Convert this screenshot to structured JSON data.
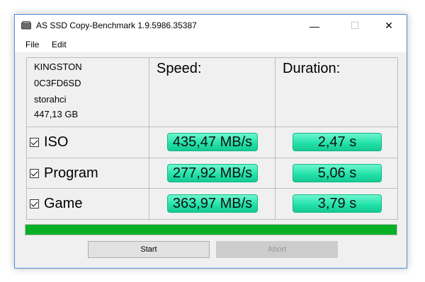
{
  "window": {
    "title": "AS SSD Copy-Benchmark 1.9.5986.35387"
  },
  "titlebar": {
    "minimize_glyph": "—",
    "maximize_glyph": "☐",
    "close_glyph": "✕"
  },
  "menu": [
    "File",
    "Edit"
  ],
  "drive_info": {
    "model": "KINGSTON",
    "firmware": "0C3FD6SD",
    "driver": "storahci",
    "size": "447,13 GB"
  },
  "headers": {
    "speed": "Speed:",
    "duration": "Duration:"
  },
  "rows": [
    {
      "label": "ISO",
      "checked": true,
      "speed": "435,47 MB/s",
      "duration": "2,47 s"
    },
    {
      "label": "Program",
      "checked": true,
      "speed": "277,92 MB/s",
      "duration": "5,06 s"
    },
    {
      "label": "Game",
      "checked": true,
      "speed": "363,97 MB/s",
      "duration": "3,79 s"
    }
  ],
  "progress": {
    "value": 1.0,
    "color": "#06b025"
  },
  "buttons": {
    "start": "Start",
    "abort": "Abort"
  },
  "colors": {
    "result_fill": "#1fe0a8",
    "window_border": "#4a90d9"
  }
}
